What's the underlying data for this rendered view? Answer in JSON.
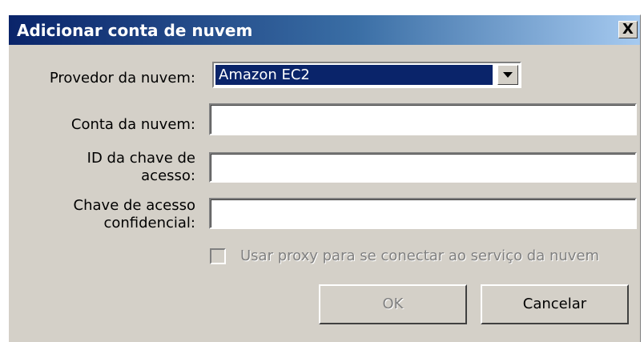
{
  "dialog": {
    "title": "Adicionar conta de nuvem",
    "close_label": "X"
  },
  "form": {
    "provider_label": "Provedor da nuvem:",
    "provider_value": "Amazon EC2",
    "account_label": "Conta da nuvem:",
    "account_value": "",
    "access_key_label_line1": "ID da chave de",
    "access_key_label_line2": "acesso:",
    "access_key_value": "",
    "secret_key_label_line1": "Chave de acesso",
    "secret_key_label_line2": "confidencial:",
    "secret_key_value": "",
    "proxy_label": "Usar proxy para se conectar ao serviço da nuvem",
    "proxy_checked": false
  },
  "buttons": {
    "ok_label": "OK",
    "cancel_label": "Cancelar"
  },
  "colors": {
    "title_gradient_start": "#0a246a",
    "title_gradient_end": "#a6caf0",
    "dialog_face": "#d4d0c8",
    "selection": "#0a246a",
    "disabled_text": "#808080"
  },
  "icons": {
    "close": "close-icon",
    "dropdown": "chevron-down-icon"
  }
}
